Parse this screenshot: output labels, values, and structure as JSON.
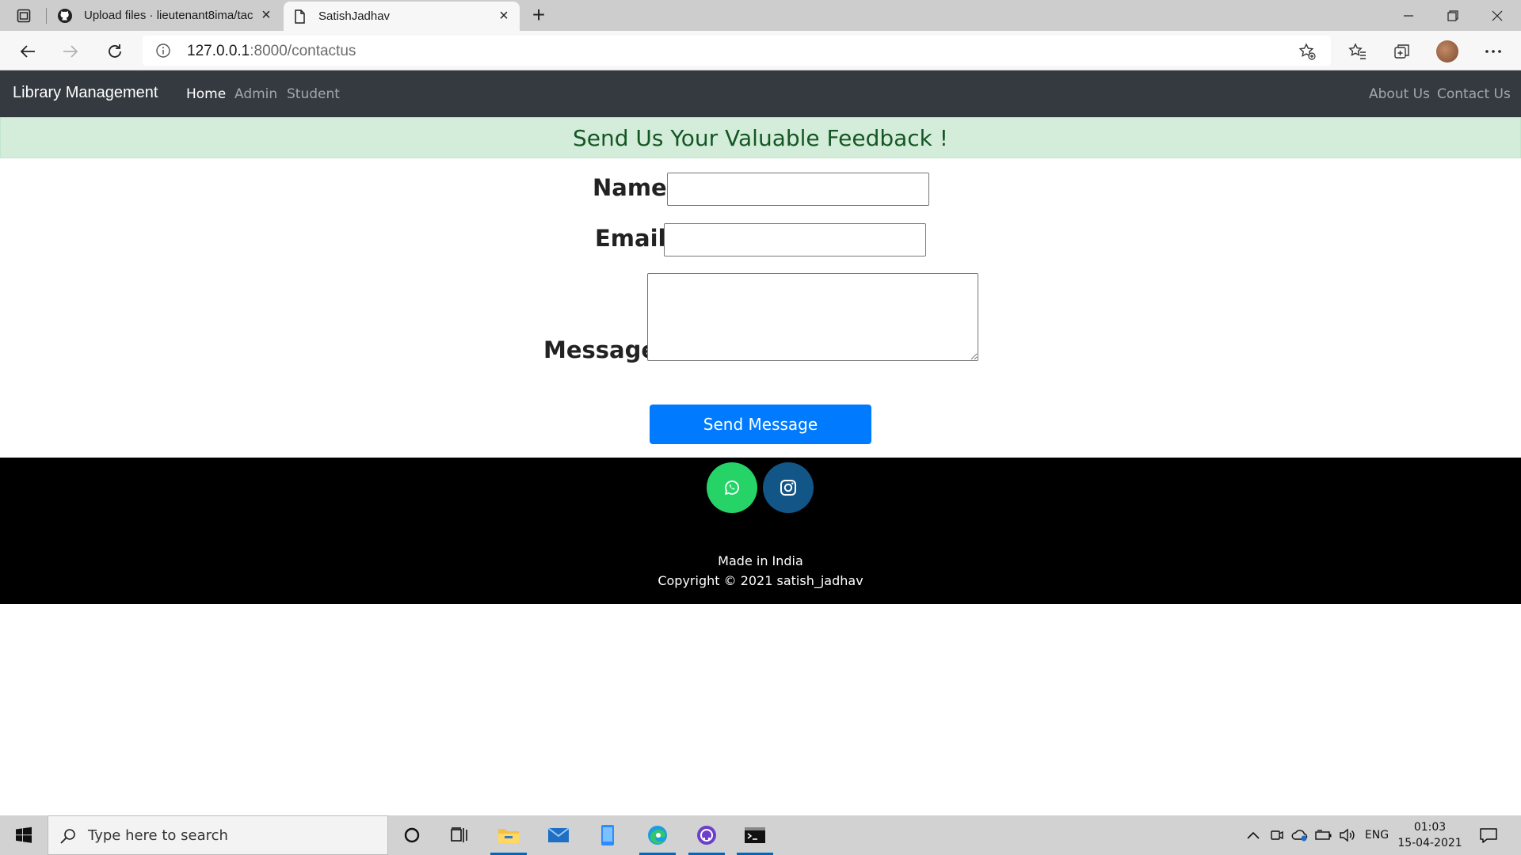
{
  "browser": {
    "tabs": [
      {
        "title": "Upload files · lieutenant8ima/tac",
        "icon": "github-icon",
        "active": false
      },
      {
        "title": "SatishJadhav",
        "icon": "page-icon",
        "active": true
      }
    ],
    "url_host": "127.0.0.1",
    "url_path": ":8000/contactus"
  },
  "navbar": {
    "brand": "Library Management",
    "links": [
      {
        "label": "Home"
      },
      {
        "label": "Admin"
      },
      {
        "label": "Student"
      }
    ],
    "right_links": [
      {
        "label": "About Us"
      },
      {
        "label": "Contact Us"
      }
    ]
  },
  "alert": {
    "text": "Send Us Your Valuable Feedback !"
  },
  "form": {
    "name_label": "Name:",
    "name_value": "",
    "email_label": "Email:",
    "email_value": "",
    "message_label": "Message:",
    "message_value": "",
    "submit_label": "Send Message"
  },
  "footer": {
    "line1": "Made in India",
    "line2": "Copyright © 2021 satish_jadhav"
  },
  "taskbar": {
    "search_placeholder": "Type here to search",
    "language": "ENG",
    "time": "01:03",
    "date": "15-04-2021"
  },
  "colors": {
    "navbar_bg": "#343a40",
    "alert_bg": "#d4edda",
    "alert_text": "#155724",
    "primary": "#007bff",
    "whatsapp": "#25d366",
    "instagram": "#125688"
  }
}
